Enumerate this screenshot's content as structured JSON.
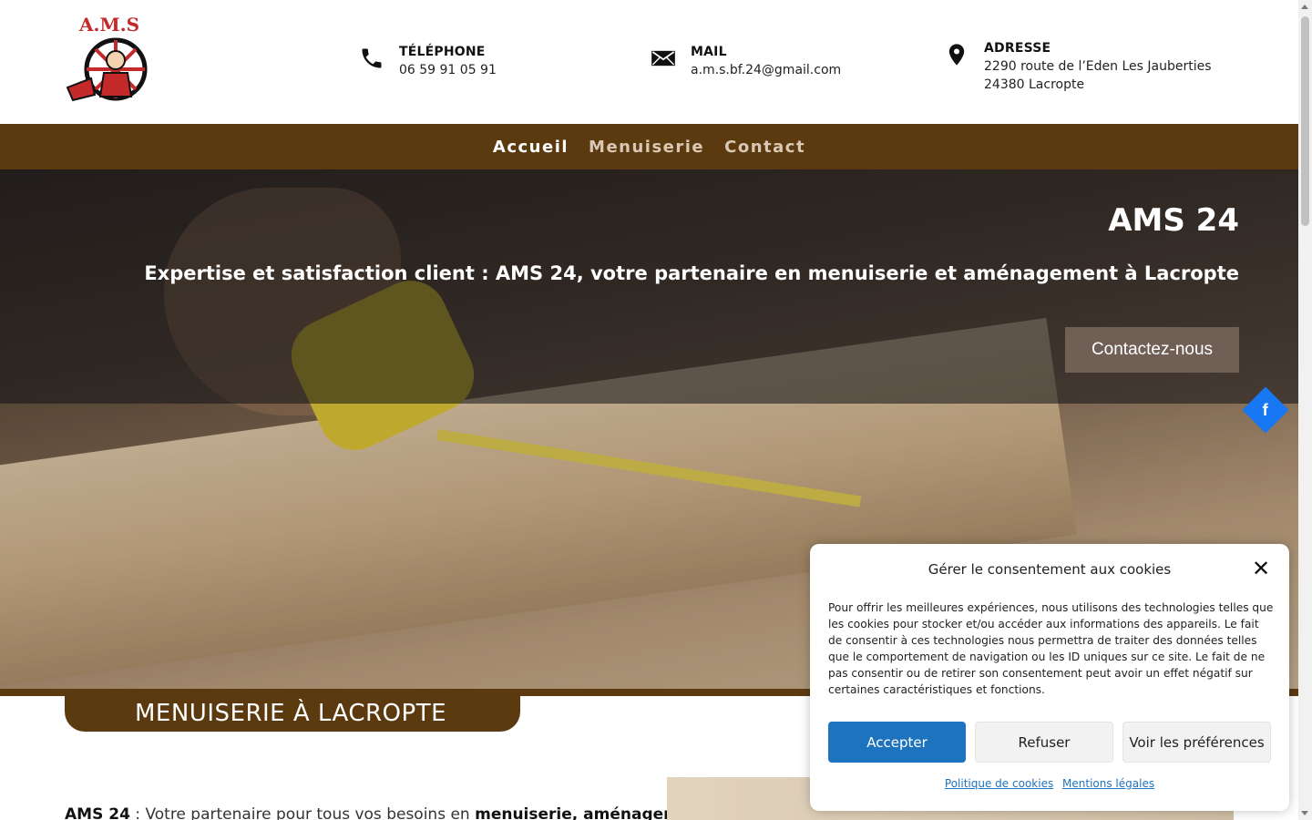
{
  "header": {
    "logo_text": "A.M.S",
    "phone": {
      "label": "TÉLÉPHONE",
      "value": "06 59 91 05 91",
      "icon": "phone-icon"
    },
    "mail": {
      "label": "MAIL",
      "value": "a.m.s.bf.24@gmail.com",
      "icon": "envelope-icon"
    },
    "address": {
      "label": "ADRESSE",
      "line1": "2290 route de l’Eden Les Jauberties",
      "line2": "24380 Lacropte",
      "icon": "map-pin-icon"
    }
  },
  "nav": {
    "items": [
      {
        "label": "Accueil",
        "active": true
      },
      {
        "label": "Menuiserie",
        "active": false
      },
      {
        "label": "Contact",
        "active": false
      }
    ]
  },
  "hero": {
    "title": "AMS 24",
    "subtitle": "Expertise et satisfaction client : AMS 24, votre partenaire en menuiserie et aménagement à Lacropte",
    "cta": "Contactez-nous"
  },
  "social": {
    "facebook": "f"
  },
  "section": {
    "banner": "MENUISERIE À LACROPTE",
    "para_lead": "AMS 24",
    "para_mid": " : Votre partenaire pour tous vos besoins en ",
    "para_bold": "menuiserie, aménagement"
  },
  "cookie": {
    "title": "Gérer le consentement aux cookies",
    "text": "Pour offrir les meilleures expériences, nous utilisons des technologies telles que les cookies pour stocker et/ou accéder aux informations des appareils. Le fait de consentir à ces technologies nous permettra de traiter des données telles que le comportement de navigation ou les ID uniques sur ce site. Le fait de ne pas consentir ou de retirer son consentement peut avoir un effet négatif sur certaines caractéristiques et fonctions.",
    "accept": "Accepter",
    "refuse": "Refuser",
    "prefs": "Voir les préférences",
    "link_policy": "Politique de cookies",
    "link_legal": "Mentions légales",
    "close": "✕"
  },
  "colors": {
    "brand_brown": "#5c3a10",
    "accept_blue": "#1e73be",
    "cta_bg": "#6f5f55",
    "facebook": "#1877f2"
  }
}
